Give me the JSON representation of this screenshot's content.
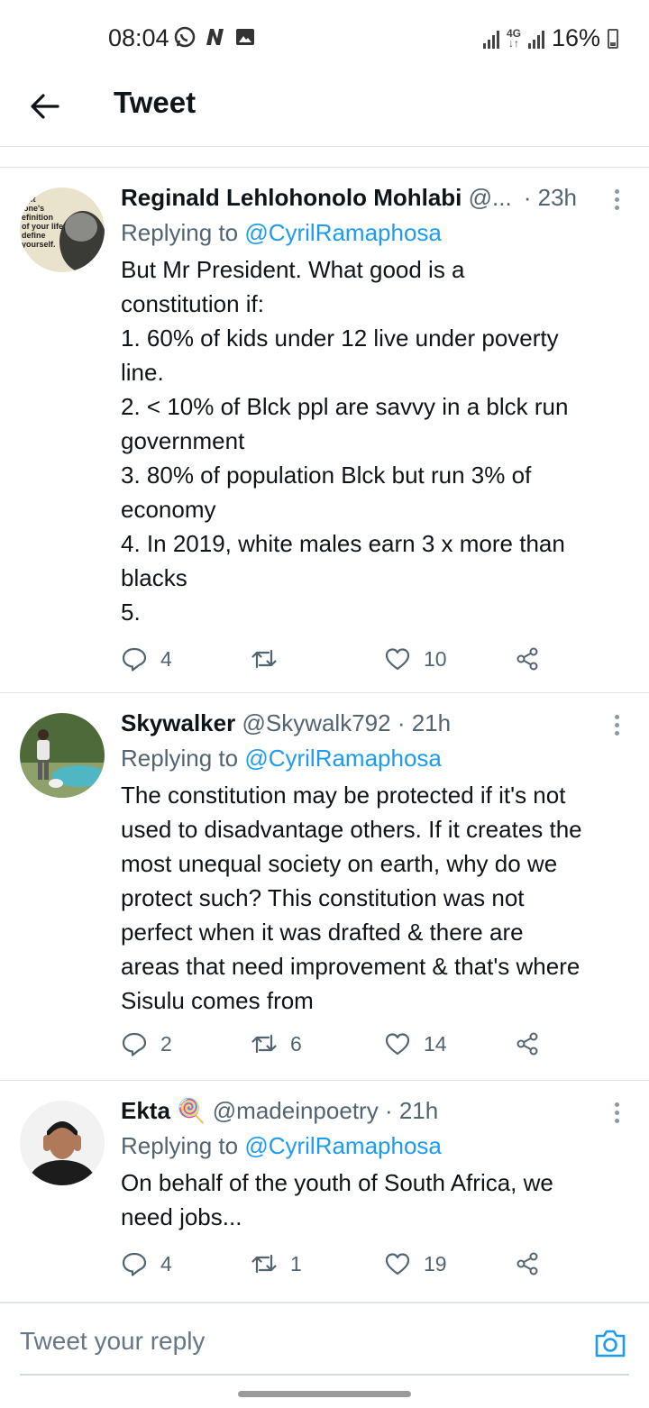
{
  "status_bar": {
    "time": "08:04",
    "network": "4G",
    "battery": "16%"
  },
  "header": {
    "title": "Tweet"
  },
  "tweets": [
    {
      "name": "Reginald Lehlohonolo Mohlabi",
      "handle": "@...",
      "time": "· 23h",
      "replying_label": "Replying to",
      "replying_handle": "@CyrilRamaphosa",
      "body": "But Mr President. What good is a\nconstitution if:\n1. 60% of kids under 12 live under poverty\nline.\n2. < 10% of Blck ppl are savvy in a blck run\ngovernment\n3. 80% of population Blck but run 3% of\neconomy\n4. In 2019, white males earn 3 x more than\nblacks\n5.",
      "avatar_text": "ept\none's\nefinition\nof your life;\ndefine\nyourself.",
      "replies": "4",
      "retweets": "",
      "likes": "10"
    },
    {
      "name": "Skywalker",
      "handle": "@Skywalk792",
      "time": "· 21h",
      "replying_label": "Replying to",
      "replying_handle": "@CyrilRamaphosa",
      "body": "The constitution may be protected if it's not\nused to disadvantage others. If it creates the\nmost unequal society on earth, why do we\nprotect such? This constitution was not\nperfect when it was drafted & there are\nareas that need improvement & that's where\nSisulu comes from",
      "replies": "2",
      "retweets": "6",
      "likes": "14"
    },
    {
      "name": "Ekta",
      "emoji": "🍭",
      "handle": "@madeinpoetry",
      "time": "· 21h",
      "replying_label": "Replying to",
      "replying_handle": "@CyrilRamaphosa",
      "body": "On behalf of the youth of South Africa, we\nneed jobs...",
      "replies": "4",
      "retweets": "1",
      "likes": "19"
    }
  ],
  "composer": {
    "placeholder": "Tweet your reply"
  },
  "colors": {
    "accent": "#1d9bf0",
    "text": "#0f1419",
    "muted": "#536471",
    "divider": "#e1e5e8"
  },
  "icons": [
    "back-arrow-icon",
    "reply-icon",
    "retweet-icon",
    "like-icon",
    "share-icon",
    "more-icon",
    "camera-icon"
  ]
}
